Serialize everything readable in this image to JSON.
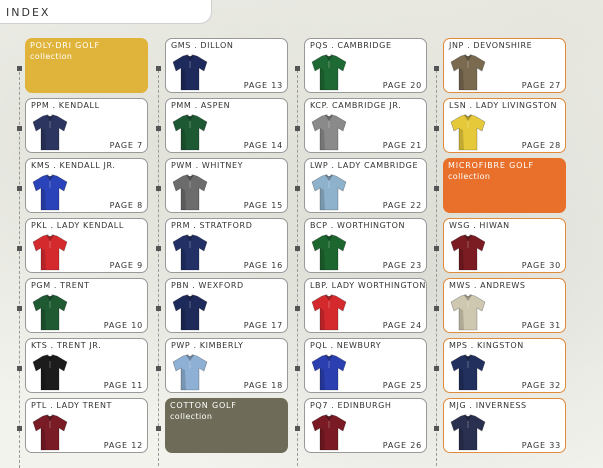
{
  "index_title": "INDEX",
  "categories": {
    "polydri": {
      "title": "POLY-DRI GOLF",
      "sub": "collection",
      "color": "#e0b43a"
    },
    "cotton": {
      "title": "COTTON GOLF",
      "sub": "collection",
      "color": "#6e6c58"
    },
    "microfibre": {
      "title": "MICROFIBRE GOLF",
      "sub": "collection",
      "color": "#e8702a"
    }
  },
  "products": [
    {
      "code": "PPM . KENDALL",
      "page": "PAGE 7",
      "color": "#2c3560"
    },
    {
      "code": "KMS . KENDALL JR.",
      "page": "PAGE 8",
      "color": "#2a43b8"
    },
    {
      "code": "PKL . LADY KENDALL",
      "page": "PAGE 9",
      "color": "#d42a2e"
    },
    {
      "code": "PGM . TRENT",
      "page": "PAGE 10",
      "color": "#1f5a32"
    },
    {
      "code": "KTS . TRENT JR.",
      "page": "PAGE 11",
      "color": "#1c1c1c"
    },
    {
      "code": "PTL . LADY TRENT",
      "page": "PAGE 12",
      "color": "#7a1c26"
    },
    {
      "code": "GMS . DILLON",
      "page": "PAGE 13",
      "color": "#1f2a5c"
    },
    {
      "code": "PMM . ASPEN",
      "page": "PAGE 14",
      "color": "#1d5a34"
    },
    {
      "code": "PWM . WHITNEY",
      "page": "PAGE 15",
      "color": "#6c6c6c"
    },
    {
      "code": "PRM . STRATFORD",
      "page": "PAGE 16",
      "color": "#223066"
    },
    {
      "code": "PBN . WEXFORD",
      "page": "PAGE 17",
      "color": "#1e2a5a"
    },
    {
      "code": "PWP . KIMBERLY",
      "page": "PAGE 18",
      "color": "#8eb0d4"
    },
    {
      "code": "PQS . CAMBRIDGE",
      "page": "PAGE 20",
      "color": "#1f6a34"
    },
    {
      "code": "KCP. CAMBRIDGE JR.",
      "page": "PAGE 21",
      "color": "#8a8a8a"
    },
    {
      "code": "LWP . LADY CAMBRIDGE",
      "page": "PAGE 22",
      "color": "#8eb2cc"
    },
    {
      "code": "BCP . WORTHINGTON",
      "page": "PAGE 23",
      "color": "#1e6630"
    },
    {
      "code": "LBP. LADY WORTHINGTON",
      "page": "PAGE 24",
      "color": "#d42a2e"
    },
    {
      "code": "PQL . NEWBURY",
      "page": "PAGE 25",
      "color": "#2b3fb0"
    },
    {
      "code": "PQ7 . EDINBURGH",
      "page": "PAGE 26",
      "color": "#7a1a24"
    },
    {
      "code": "JNP . DEVONSHIRE",
      "page": "PAGE 27",
      "color": "#7a6a50"
    },
    {
      "code": "LSN . LADY LIVINGSTON",
      "page": "PAGE 28",
      "color": "#e6c93a"
    },
    {
      "code": "WSG . HIWAN",
      "page": "PAGE 30",
      "color": "#7a1c22"
    },
    {
      "code": "MWS . ANDREWS",
      "page": "PAGE 31",
      "color": "#cfc8b0"
    },
    {
      "code": "MPS . KINGSTON",
      "page": "PAGE 32",
      "color": "#22305e"
    },
    {
      "code": "MJG . INVERNESS",
      "page": "PAGE 33",
      "color": "#2a3150"
    }
  ]
}
